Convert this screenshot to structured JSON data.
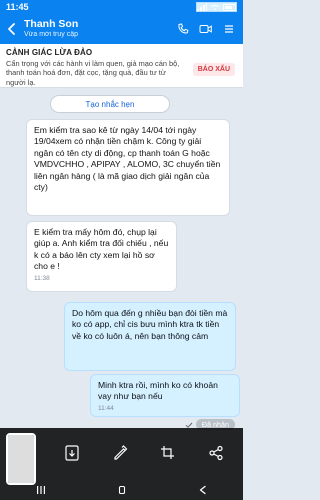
{
  "status_bar": {
    "time": "11:45"
  },
  "header": {
    "title": "Thanh Son",
    "subtitle": "Vừa mới truy cập",
    "icons": [
      "back-arrow-icon",
      "call-icon",
      "video-icon",
      "menu-icon"
    ]
  },
  "warning": {
    "title": "CẢNH GIÁC LỪA ĐẢO",
    "text": "Cẩn trọng với các hành vi làm quen, giả mạo cán bộ, thanh toán hoá đơn, đặt cọc, tặng quà, đầu tư từ người lạ.",
    "report_label": "BÁO XẤU"
  },
  "reminder": {
    "label": "Tạo nhắc hẹn"
  },
  "messages": [
    {
      "side": "left",
      "text": "Em kiểm tra sao kê từ ngày 14/04 tới ngày 19/04xem có nhận tiền chậm k. Công ty giải ngân có tên cty di động, cp thanh toán G hoặc VMDVCHHO , APIPAY , ALOMO, 3C chuyển tiền liên ngân hàng ( là mã giao dịch giải ngân của cty)",
      "time": ""
    },
    {
      "side": "left",
      "text": "E kiểm tra mấy hôm đó, chụp lại giúp a. Anh kiểm tra đối chiếu , nếu k có a báo lên cty xem lại hồ sơ cho e !",
      "time": "11:38"
    },
    {
      "side": "right",
      "text": "Do hôm qua đến g nhiều bạn đòi tiền mà ko có app, chỉ cis bưu mình ktra tk tiền về ko có luôn á, nên bạn thông cảm",
      "time": ""
    },
    {
      "side": "right",
      "text": "Minh ktra rồi, mình ko có khoản vay như bạn nếu",
      "time": "11:44"
    }
  ],
  "seen": {
    "label": "Đã nhận"
  }
}
